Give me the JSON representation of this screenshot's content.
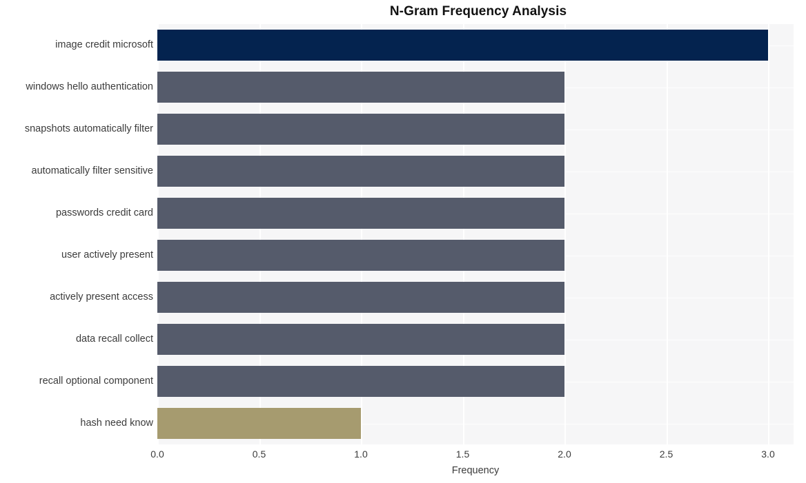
{
  "chart_data": {
    "type": "bar",
    "orientation": "horizontal",
    "title": "N-Gram Frequency Analysis",
    "xlabel": "Frequency",
    "ylabel": "",
    "xlim": [
      0,
      3.125
    ],
    "xticks": [
      "0.0",
      "0.5",
      "1.0",
      "1.5",
      "2.0",
      "2.5",
      "3.0"
    ],
    "xtick_values": [
      0.0,
      0.5,
      1.0,
      1.5,
      2.0,
      2.5,
      3.0
    ],
    "grid": true,
    "legend": "none",
    "categories": [
      "image credit microsoft",
      "windows hello authentication",
      "snapshots automatically filter",
      "automatically filter sensitive",
      "passwords credit card",
      "user actively present",
      "actively present access",
      "data recall collect",
      "recall optional component",
      "hash need know"
    ],
    "values": [
      3,
      2,
      2,
      2,
      2,
      2,
      2,
      2,
      2,
      1
    ],
    "bar_colors": [
      "#04234f",
      "#555b6b",
      "#555b6b",
      "#555b6b",
      "#555b6b",
      "#555b6b",
      "#555b6b",
      "#555b6b",
      "#555b6b",
      "#a69b6f"
    ]
  },
  "style": {
    "figure_background": "#ffffff",
    "plot_background": "#f6f6f7",
    "grid_color": "#ffffff",
    "text_color": "#3b3b3b",
    "title_color": "#111111"
  }
}
